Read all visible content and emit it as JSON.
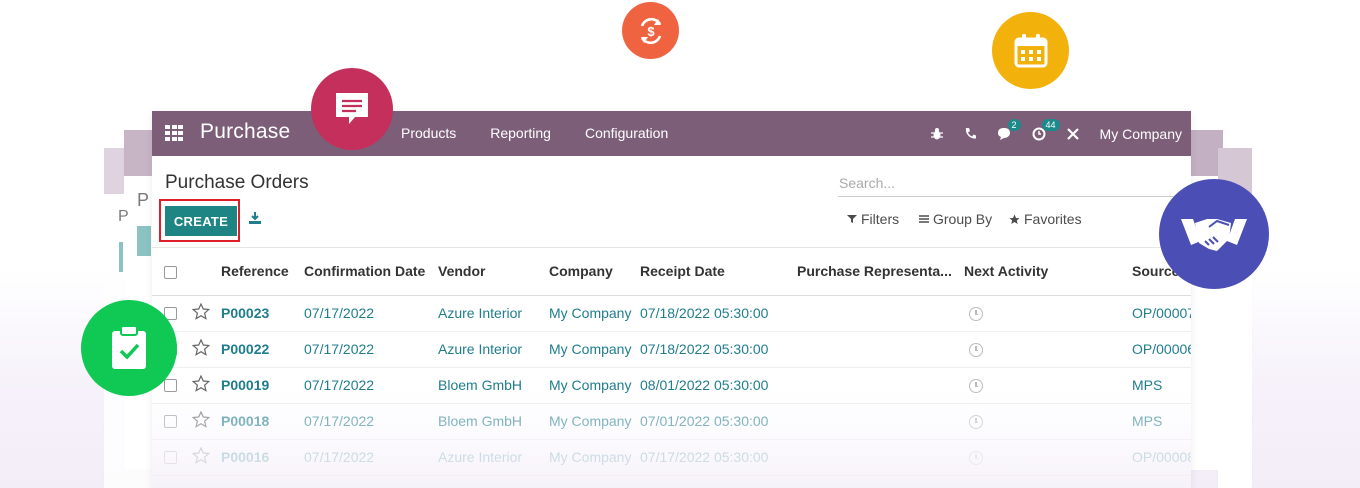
{
  "topbar": {
    "app_title": "Purchase",
    "menu": [
      "Products",
      "Reporting",
      "Configuration"
    ],
    "chat_badge": "2",
    "activity_badge": "44",
    "company": "My Company"
  },
  "control_panel": {
    "title": "Purchase Orders",
    "search_placeholder": "Search...",
    "create_label": "CREATE",
    "filters_label": "Filters",
    "group_by_label": "Group By",
    "favorites_label": "Favorites"
  },
  "background": {
    "left_letter_1": "P",
    "left_letter_2": "P"
  },
  "table": {
    "columns": [
      "Reference",
      "Confirmation Date",
      "Vendor",
      "Company",
      "Receipt Date",
      "Purchase Representa...",
      "Next Activity",
      "Source"
    ],
    "rows": [
      {
        "reference": "P00023",
        "confirmation_date": "07/17/2022",
        "vendor": "Azure Interior",
        "company": "My Company",
        "receipt_date": "07/18/2022 05:30:00",
        "source": "OP/00007"
      },
      {
        "reference": "P00022",
        "confirmation_date": "07/17/2022",
        "vendor": "Azure Interior",
        "company": "My Company",
        "receipt_date": "07/18/2022 05:30:00",
        "source": "OP/00006"
      },
      {
        "reference": "P00019",
        "confirmation_date": "07/17/2022",
        "vendor": "Bloem GmbH",
        "company": "My Company",
        "receipt_date": "08/01/2022 05:30:00",
        "source": "MPS"
      },
      {
        "reference": "P00018",
        "confirmation_date": "07/17/2022",
        "vendor": "Bloem GmbH",
        "company": "My Company",
        "receipt_date": "07/01/2022 05:30:00",
        "source": "MPS"
      },
      {
        "reference": "P00016",
        "confirmation_date": "07/17/2022",
        "vendor": "Azure Interior",
        "company": "My Company",
        "receipt_date": "07/17/2022 05:30:00",
        "source": "OP/00008"
      }
    ]
  },
  "colors": {
    "topbar": "#7c5e78",
    "primary": "#1f8584",
    "link": "#1f7d8d",
    "highlight_border": "#e01e2a",
    "circle_chat": "#c4305b",
    "circle_money": "#f06340",
    "circle_calendar": "#f3b10b",
    "circle_handshake": "#4b4eb5",
    "circle_clipboard": "#10c955"
  },
  "decor_icons": [
    "chat-icon",
    "money-refresh-icon",
    "calendar-icon",
    "handshake-icon",
    "clipboard-check-icon"
  ]
}
